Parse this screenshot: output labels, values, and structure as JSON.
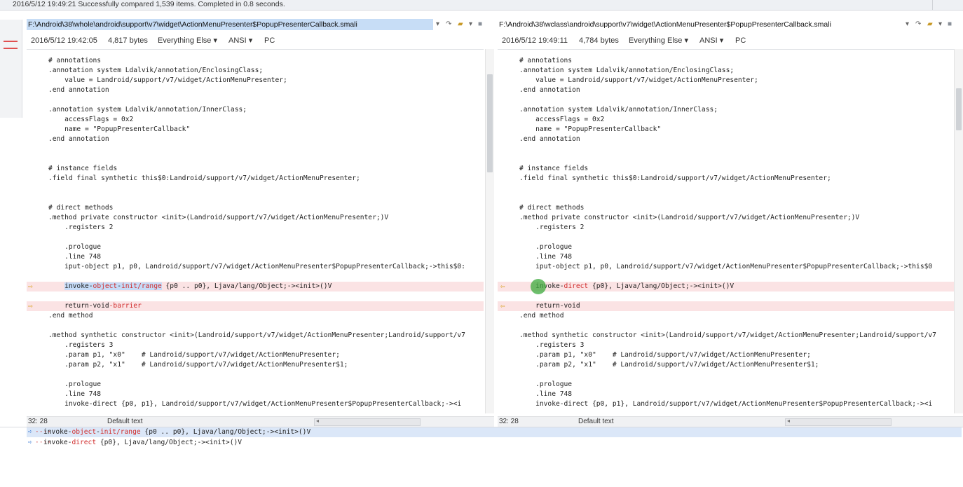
{
  "status": {
    "message": "2016/5/12 19:49:21  Successfully compared 1,539 items.  Completed in 0.8 seconds."
  },
  "left": {
    "path": "F:\\Android\\38\\whole\\android\\support\\v7\\widget\\ActionMenuPresenter$PopupPresenterCallback.smali",
    "timestamp": "2016/5/12 19:42:05",
    "size": "4,817 bytes",
    "format": "Everything Else",
    "encoding": "ANSI",
    "lineending": "PC",
    "cursor": "32: 28",
    "status_encoding": "Default text",
    "lines": [
      "# annotations",
      ".annotation system Ldalvik/annotation/EnclosingClass;",
      "    value = Landroid/support/v7/widget/ActionMenuPresenter;",
      ".end annotation",
      "",
      ".annotation system Ldalvik/annotation/InnerClass;",
      "    accessFlags = 0x2",
      "    name = \"PopupPresenterCallback\"",
      ".end annotation",
      "",
      "",
      "# instance fields",
      ".field final synthetic this$0:Landroid/support/v7/widget/ActionMenuPresenter;",
      "",
      "",
      "# direct methods",
      ".method private constructor <init>(Landroid/support/v7/widget/ActionMenuPresenter;)V",
      "    .registers 2",
      "",
      "    .prologue",
      "    .line 748",
      "    iput-object p1, p0, Landroid/support/v7/widget/ActionMenuPresenter$PopupPresenterCallback;->this$0:",
      "",
      "    invoke-object-init/range {p0 .. p0}, Ljava/lang/Object;-><init>()V",
      "",
      "    return-void-barrier",
      ".end method",
      "",
      ".method synthetic constructor <init>(Landroid/support/v7/widget/ActionMenuPresenter;Landroid/support/v7",
      "    .registers 3",
      "    .param p1, \"x0\"    # Landroid/support/v7/widget/ActionMenuPresenter;",
      "    .param p2, \"x1\"    # Landroid/support/v7/widget/ActionMenuPresenter$1;",
      "",
      "    .prologue",
      "    .line 748",
      "    invoke-direct {p0, p1}, Landroid/support/v7/widget/ActionMenuPresenter$PopupPresenterCallback;-><i"
    ]
  },
  "right": {
    "path": "F:\\Android\\38\\wclass\\android\\support\\v7\\widget\\ActionMenuPresenter$PopupPresenterCallback.smali",
    "timestamp": "2016/5/12 19:49:11",
    "size": "4,784 bytes",
    "format": "Everything Else",
    "encoding": "ANSI",
    "lineending": "PC",
    "cursor": "32: 28",
    "status_encoding": "Default text",
    "lines": [
      "# annotations",
      ".annotation system Ldalvik/annotation/EnclosingClass;",
      "    value = Landroid/support/v7/widget/ActionMenuPresenter;",
      ".end annotation",
      "",
      ".annotation system Ldalvik/annotation/InnerClass;",
      "    accessFlags = 0x2",
      "    name = \"PopupPresenterCallback\"",
      ".end annotation",
      "",
      "",
      "# instance fields",
      ".field final synthetic this$0:Landroid/support/v7/widget/ActionMenuPresenter;",
      "",
      "",
      "# direct methods",
      ".method private constructor <init>(Landroid/support/v7/widget/ActionMenuPresenter;)V",
      "    .registers 2",
      "",
      "    .prologue",
      "    .line 748",
      "    iput-object p1, p0, Landroid/support/v7/widget/ActionMenuPresenter$PopupPresenterCallback;->this$0",
      "",
      "    invoke-direct {p0}, Ljava/lang/Object;-><init>()V",
      "",
      "    return-void",
      ".end method",
      "",
      ".method synthetic constructor <init>(Landroid/support/v7/widget/ActionMenuPresenter;Landroid/support/v7",
      "    .registers 3",
      "    .param p1, \"x0\"    # Landroid/support/v7/widget/ActionMenuPresenter;",
      "    .param p2, \"x1\"    # Landroid/support/v7/widget/ActionMenuPresenter$1;",
      "",
      "    .prologue",
      "    .line 748",
      "    invoke-direct {p0, p1}, Landroid/support/v7/widget/ActionMenuPresenter$PopupPresenterCallback;-><i"
    ]
  },
  "diff_lines": [
    23,
    25
  ],
  "bottom": {
    "line1": "invoke-object-init/range {p0 .. p0}, Ljava/lang/Object;-><init>()V",
    "line2": "invoke-direct {p0}, Ljava/lang/Object;-><init>()V"
  },
  "icons": {
    "diff_arrow_left": "arrow-right-icon",
    "diff_arrow_right": "arrow-left-icon",
    "folder": "folder-open-icon",
    "save": "disk-icon"
  },
  "colors": {
    "diff_bg": "#fbe3e4",
    "diff_text": "#d02b2b",
    "selection": "#c6dbf7",
    "marker": "#d8a020"
  }
}
